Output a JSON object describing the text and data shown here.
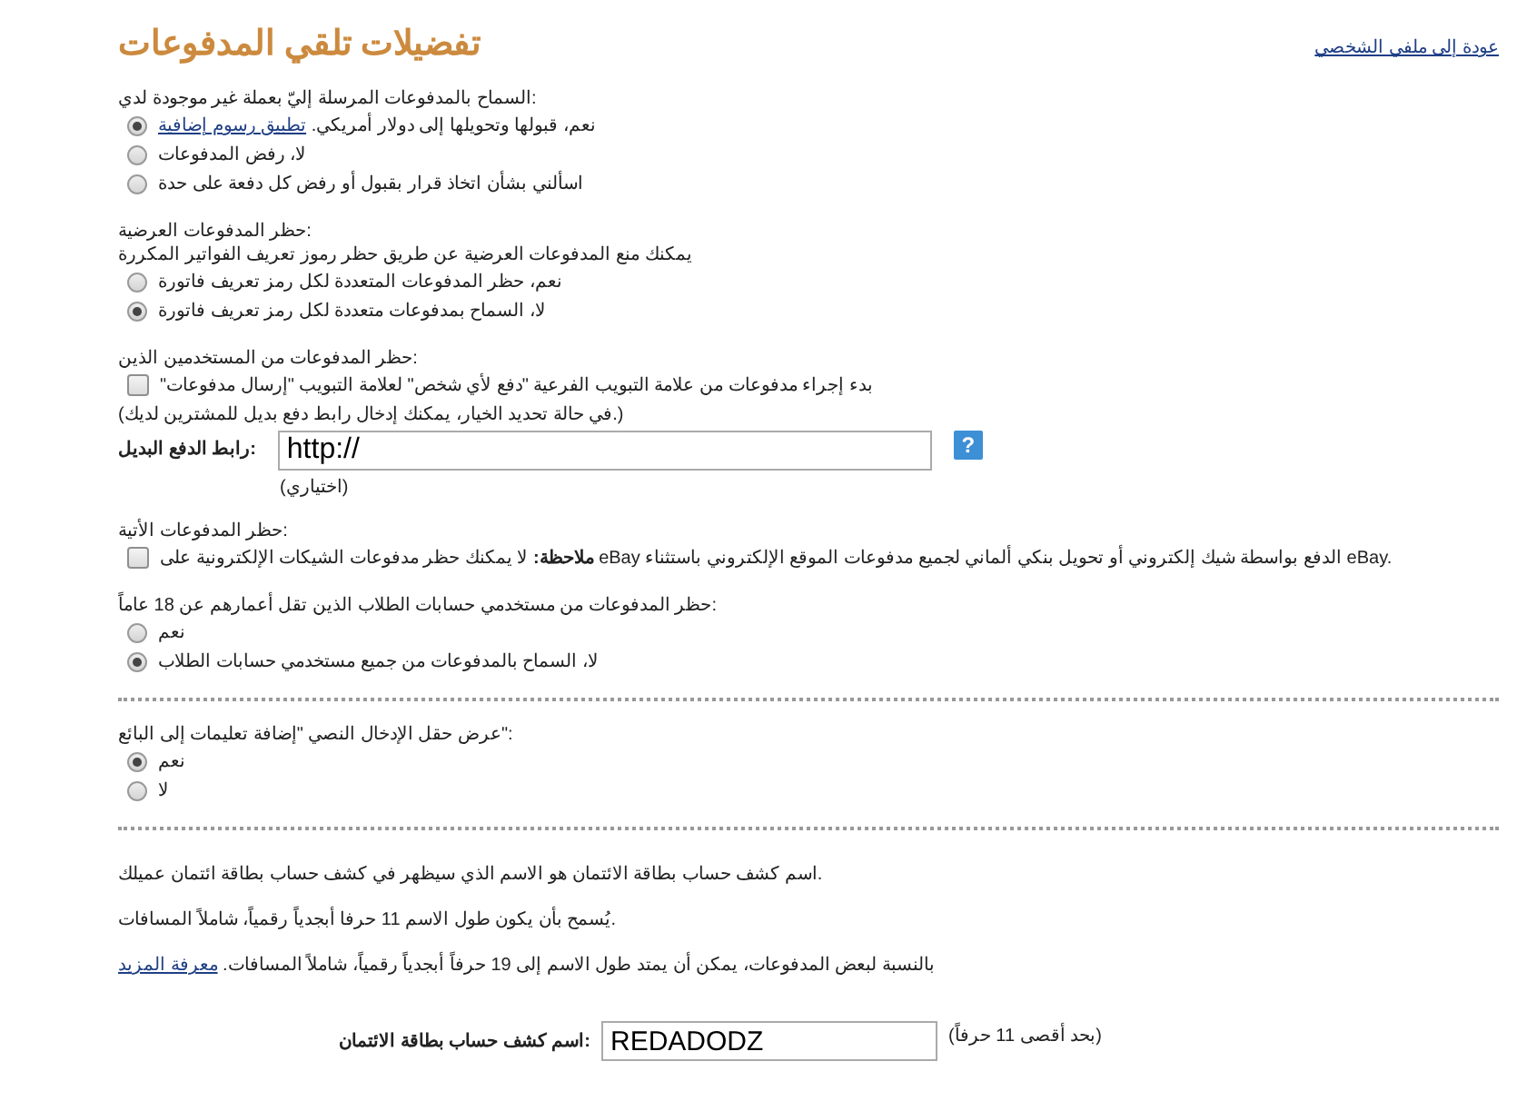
{
  "header": {
    "title": "تفضيلات تلقي المدفوعات",
    "back_link": "عودة إلى ملفي الشخصي"
  },
  "blocks": [
    {
      "kind": "radio_group",
      "label": "السماح بالمدفوعات المرسلة إليّ بعملة غير موجودة لدي:",
      "options": [
        {
          "text": "نعم، قبولها وتحويلها إلى دولار أمريكي. ",
          "link": "تطبيق رسوم إضافية",
          "selected": true
        },
        {
          "text": "لا، رفض المدفوعات",
          "selected": false
        },
        {
          "text": "اسألني بشأن اتخاذ قرار بقبول أو رفض كل دفعة على حدة",
          "selected": false
        }
      ]
    },
    {
      "kind": "radio_group",
      "label": "حظر المدفوعات العرضية:",
      "description": "يمكنك منع المدفوعات العرضية عن طريق حظر رموز تعريف الفواتير المكررة",
      "options": [
        {
          "text": "نعم، حظر المدفوعات المتعددة لكل رمز تعريف فاتورة",
          "selected": false
        },
        {
          "text": "لا، السماح بمدفوعات متعددة لكل رمز تعريف فاتورة",
          "selected": true
        }
      ]
    },
    {
      "kind": "checkbox_group",
      "label": "حظر المدفوعات من المستخدمين الذين:",
      "options": [
        {
          "text": "\"بدء إجراء مدفوعات من علامة التبويب الفرعية \"دفع لأي شخص\" لعلامة التبويب \"إرسال مدفوعات",
          "checked": false
        }
      ],
      "hint": "(في حالة تحديد الخيار، يمكنك إدخال رابط دفع بديل للمشترين لديك.)",
      "field": {
        "label": "رابط الدفع البديل:",
        "value": "http://",
        "help": "?",
        "note": "(اختياري)"
      }
    },
    {
      "kind": "checkbox_group",
      "label": "حظر المدفوعات الأتية:",
      "options": [
        {
          "text": "**ملاحظة:** لا يمكنك حظر مدفوعات الشيكات الإلكترونية على eBay الدفع بواسطة شيك إلكتروني أو تحويل بنكي ألماني لجميع مدفوعات الموقع الإلكتروني باستثناء eBay.",
          "checked": false
        }
      ]
    },
    {
      "kind": "radio_group",
      "label": "حظر المدفوعات من مستخدمي حسابات الطلاب الذين تقل أعمارهم عن 18 عاماً:",
      "options": [
        {
          "text": "نعم",
          "selected": false
        },
        {
          "text": "لا، السماح بالمدفوعات من جميع مستخدمي حسابات الطلاب",
          "selected": true
        }
      ]
    },
    {
      "kind": "divider"
    },
    {
      "kind": "radio_group",
      "label": "عرض حقل الإدخال النصي \"إضافة تعليمات إلى البائع\":",
      "options": [
        {
          "text": "نعم",
          "selected": true
        },
        {
          "text": "لا",
          "selected": false
        }
      ]
    },
    {
      "kind": "divider"
    },
    {
      "kind": "info",
      "paragraphs": [
        {
          "text": "اسم كشف حساب بطاقة الائتمان هو الاسم الذي سيظهر في كشف حساب بطاقة ائتمان عميلك."
        },
        {
          "text": "يُسمح بأن يكون طول الاسم 11 حرفا أبجدياً رقمياً، شاملاً المسافات."
        },
        {
          "text": "بالنسبة لبعض المدفوعات، يمكن أن يمتد طول الاسم إلى 19 حرفاً أبجدياً رقمياً، شاملاً المسافات. ",
          "link": "معرفة المزيد"
        }
      ],
      "field": {
        "label": "اسم كشف حساب بطاقة الائتمان:",
        "value": "REDADODZ",
        "note": "(بحد أقصى 11 حرفاً)"
      }
    }
  ]
}
